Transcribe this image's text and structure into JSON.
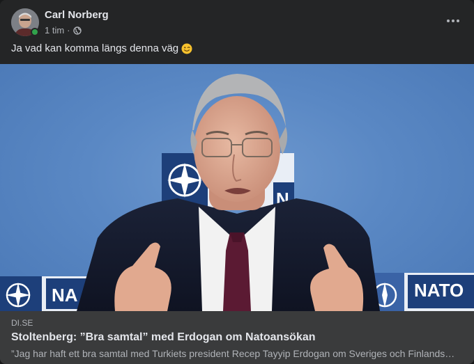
{
  "post": {
    "author": "Carl Norberg",
    "time": "1 tim",
    "separator": "·",
    "audience_icon": "globe-icon",
    "text": "Ja vad kan komma längs denna väg",
    "emoji": "winking-face-emoji",
    "more_icon": "more-options-icon"
  },
  "image": {
    "signs": [
      {
        "text": "NATO"
      },
      {
        "text": "NATO"
      },
      {
        "text": "NATO"
      }
    ]
  },
  "link": {
    "domain": "DI.SE",
    "title": "Stoltenberg: ”Bra samtal” med Erdogan om Natoansökan",
    "description": "”Jag har haft ett bra samtal med Turkiets president Recep Tayyip Erdogan om Sveriges och Finlands ansökan”"
  },
  "colors": {
    "card_bg": "#242526",
    "link_bg": "#3a3b3c",
    "primary_text": "#e4e6eb",
    "secondary_text": "#b0b3b8",
    "online": "#31a24c",
    "nato_blue": "#1d3f7a"
  }
}
